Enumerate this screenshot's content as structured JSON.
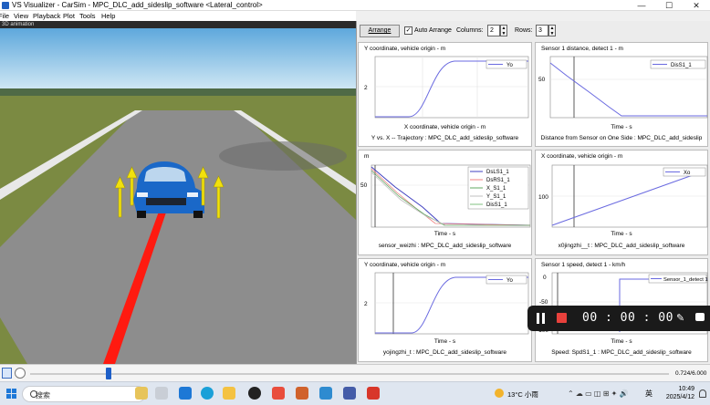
{
  "window": {
    "title": "VS Visualizer - CarSim - MPC_DLC_add_sideslip_software <Lateral_control>",
    "minimize": "—",
    "maximize": "☐",
    "close": "✕"
  },
  "menu": [
    "File",
    "View",
    "Playback",
    "Plot",
    "Tools",
    "Help"
  ],
  "view3d": {
    "label": "3D animation"
  },
  "toolbar": {
    "arrange": "Arrange",
    "auto_arrange_checked": true,
    "auto_arrange": "Auto Arrange",
    "columns_label": "Columns:",
    "columns_value": "2",
    "rows_label": "Rows:",
    "rows_value": "3"
  },
  "plots": [
    {
      "id": "p1",
      "title": "Y coordinate, vehicle origin - m",
      "xlabel": "X coordinate, vehicle origin - m",
      "caption": "Y vs. X -- Trajectory : MPC_DLC_add_sideslip_software",
      "legend": [
        "Yo"
      ],
      "yticks": [
        "2"
      ]
    },
    {
      "id": "p2",
      "title": "Sensor 1 distance, detect 1 - m",
      "xlabel": "Time - s",
      "caption": "Distance from Sensor on One Side : MPC_DLC_add_sideslip",
      "legend": [
        "DisS1_1"
      ],
      "yticks": [
        "50"
      ]
    },
    {
      "id": "p3",
      "title": "m",
      "xlabel": "Time - s",
      "caption": "sensor_weizhi : MPC_DLC_add_sideslip_software",
      "legend": [
        "DsLS1_1",
        "DsRS1_1",
        "X_S1_1",
        "Y_S1_1",
        "DisS1_1"
      ],
      "yticks": [
        "50"
      ]
    },
    {
      "id": "p4",
      "title": "X coordinate, vehicle origin - m",
      "xlabel": "Time - s",
      "caption": "x0jingzhi__t : MPC_DLC_add_sideslip_software",
      "legend": [
        "Xo"
      ],
      "yticks": [
        "100"
      ]
    },
    {
      "id": "p5",
      "title": "Y coordinate, vehicle origin - m",
      "xlabel": "Time - s",
      "caption": "yojingzhi_t : MPC_DLC_add_sideslip_software",
      "legend": [
        "Yo"
      ],
      "yticks": [
        "2"
      ]
    },
    {
      "id": "p6",
      "title": "Sensor 1 speed, detect 1 - km/h",
      "xlabel": "Time - s",
      "caption": "Speed: SpdS1_1 : MPC_DLC_add_sideslip_software",
      "legend": [
        "Sensor_1_detect 1"
      ],
      "yticks": [
        "0",
        "-50",
        "-100"
      ]
    }
  ],
  "recorder": {
    "time": "00 : 00 : 00",
    "pen": "✎"
  },
  "playback": {
    "time": "0.724/6.000"
  },
  "taskbar": {
    "search": "搜索",
    "weather": "13°C 小雨",
    "tray": "⌃ ☁ ▭ ◫ ⊞ ✦ 🔊",
    "lang": "英",
    "time": "10:49",
    "date": "2025/4/12"
  },
  "colors": {
    "accent": "#1e5fc8",
    "plot_line": "#6a6ae0",
    "grass": "#7b8a42",
    "car": "#1a68c8",
    "ray": "#ff1a10",
    "arrow": "#f2e10c",
    "record": "#e8413c"
  }
}
